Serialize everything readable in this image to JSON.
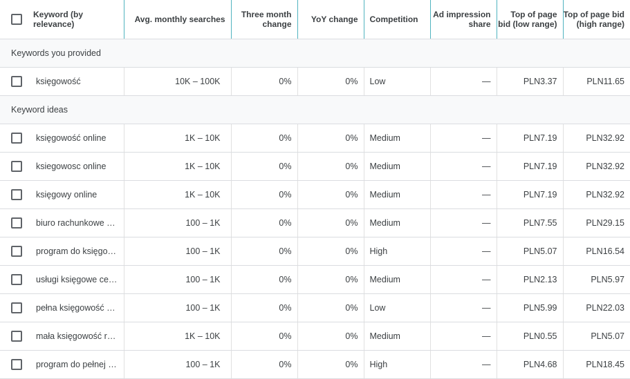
{
  "headers": {
    "keyword": "Keyword (by relevance)",
    "avg_searches": "Avg. monthly searches",
    "three_month": "Three month change",
    "yoy": "YoY change",
    "competition": "Competition",
    "ad_share": "Ad impression share",
    "bid_low": "Top of page bid (low range)",
    "bid_high": "Top of page bid (high range)"
  },
  "groups": {
    "provided": "Keywords you provided",
    "ideas": "Keyword ideas"
  },
  "provided": [
    {
      "keyword": "księgowość",
      "avg": "10K – 100K",
      "three": "0%",
      "yoy": "0%",
      "comp": "Low",
      "share": "—",
      "low": "PLN3.37",
      "high": "PLN11.65"
    }
  ],
  "ideas": [
    {
      "keyword": "księgowość online",
      "avg": "1K – 10K",
      "three": "0%",
      "yoy": "0%",
      "comp": "Medium",
      "share": "—",
      "low": "PLN7.19",
      "high": "PLN32.92"
    },
    {
      "keyword": "ksiegowosc online",
      "avg": "1K – 10K",
      "three": "0%",
      "yoy": "0%",
      "comp": "Medium",
      "share": "—",
      "low": "PLN7.19",
      "high": "PLN32.92"
    },
    {
      "keyword": "księgowy online",
      "avg": "1K – 10K",
      "three": "0%",
      "yoy": "0%",
      "comp": "Medium",
      "share": "—",
      "low": "PLN7.19",
      "high": "PLN32.92"
    },
    {
      "keyword": "biuro rachunkowe o...",
      "avg": "100 – 1K",
      "three": "0%",
      "yoy": "0%",
      "comp": "Medium",
      "share": "—",
      "low": "PLN7.55",
      "high": "PLN29.15"
    },
    {
      "keyword": "program do księgow...",
      "avg": "100 – 1K",
      "three": "0%",
      "yoy": "0%",
      "comp": "High",
      "share": "—",
      "low": "PLN5.07",
      "high": "PLN16.54"
    },
    {
      "keyword": "usługi księgowe cen...",
      "avg": "100 – 1K",
      "three": "0%",
      "yoy": "0%",
      "comp": "Medium",
      "share": "—",
      "low": "PLN2.13",
      "high": "PLN5.97"
    },
    {
      "keyword": "pełna księgowość o...",
      "avg": "100 – 1K",
      "three": "0%",
      "yoy": "0%",
      "comp": "Low",
      "share": "—",
      "low": "PLN5.99",
      "high": "PLN22.03"
    },
    {
      "keyword": "mała księgowość rz...",
      "avg": "1K – 10K",
      "three": "0%",
      "yoy": "0%",
      "comp": "Medium",
      "share": "—",
      "low": "PLN0.55",
      "high": "PLN5.07"
    },
    {
      "keyword": "program do pełnej k...",
      "avg": "100 – 1K",
      "three": "0%",
      "yoy": "0%",
      "comp": "High",
      "share": "—",
      "low": "PLN4.68",
      "high": "PLN18.45"
    }
  ]
}
